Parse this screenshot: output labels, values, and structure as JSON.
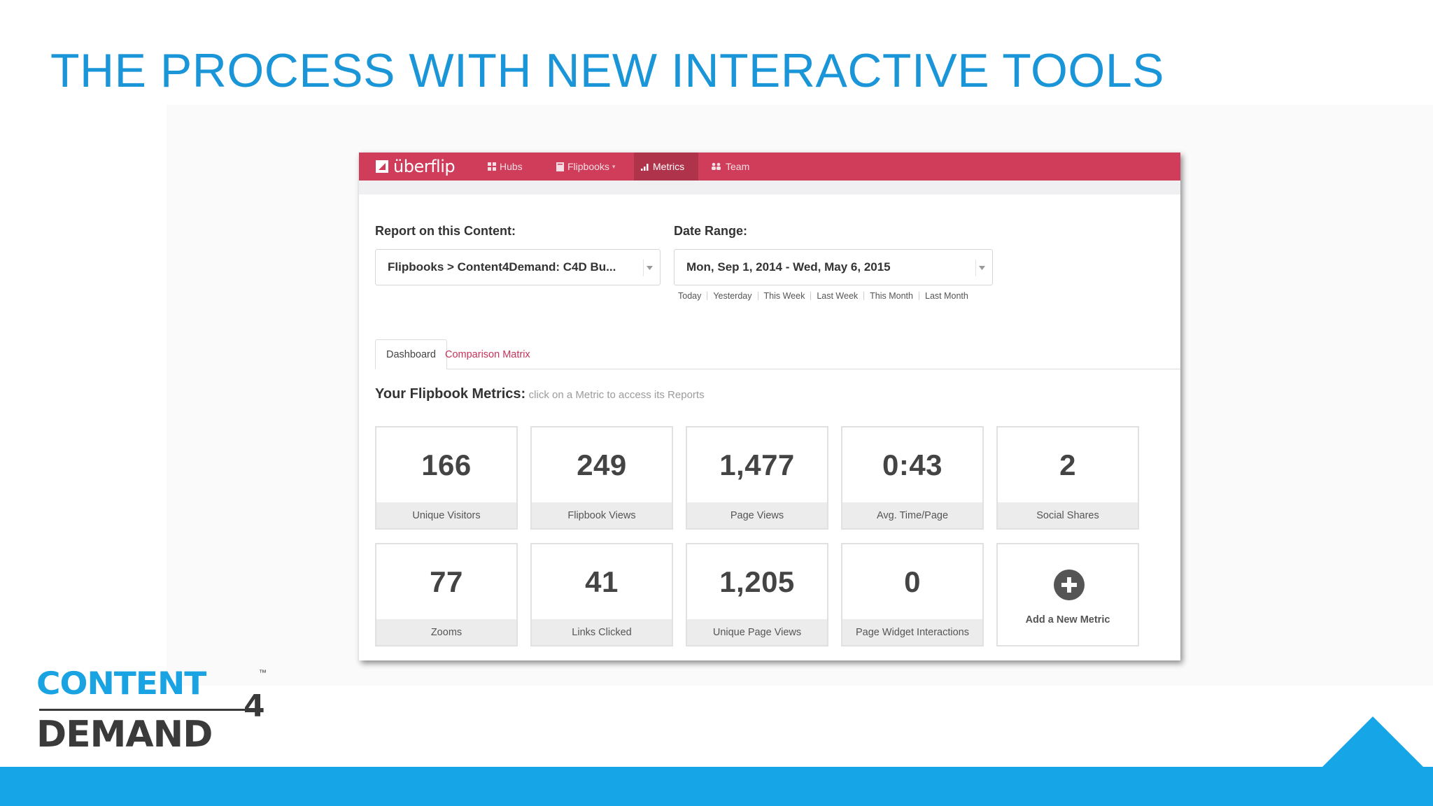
{
  "slide": {
    "title": "THE PROCESS WITH NEW INTERACTIVE TOOLS"
  },
  "app": {
    "logo_text": "überflip",
    "nav": [
      {
        "label": "Hubs",
        "icon": "grid-icon"
      },
      {
        "label": "Flipbooks",
        "icon": "book-icon"
      },
      {
        "label": "Metrics",
        "icon": "bar-chart-icon",
        "active": true
      },
      {
        "label": "Team",
        "icon": "people-icon"
      }
    ],
    "report": {
      "label": "Report on this Content:",
      "value": "Flipbooks > Content4Demand: C4D Bu..."
    },
    "date_range": {
      "label": "Date Range:",
      "value": "Mon, Sep 1, 2014 - Wed, May 6, 2015",
      "quick_links": [
        "Today",
        "Yesterday",
        "This Week",
        "Last Week",
        "This Month",
        "Last Month"
      ]
    },
    "tabs": [
      {
        "label": "Dashboard",
        "active": true
      },
      {
        "label": "Comparison Matrix",
        "active": false
      }
    ],
    "metrics_heading": "Your Flipbook Metrics:",
    "metrics_hint": "click on a Metric to access its Reports",
    "metrics": [
      {
        "value": "166",
        "label": "Unique Visitors"
      },
      {
        "value": "249",
        "label": "Flipbook Views"
      },
      {
        "value": "1,477",
        "label": "Page Views"
      },
      {
        "value": "0:43",
        "label": "Avg. Time/Page"
      },
      {
        "value": "2",
        "label": "Social Shares"
      },
      {
        "value": "77",
        "label": "Zooms"
      },
      {
        "value": "41",
        "label": "Links Clicked"
      },
      {
        "value": "1,205",
        "label": "Unique Page Views"
      },
      {
        "value": "0",
        "label": "Page Widget Interactions"
      }
    ],
    "add_metric_label": "Add a New Metric"
  },
  "brand": {
    "content": "CONTENT",
    "demand": "DEMAND",
    "four": "4",
    "tm": "™",
    "colors": {
      "accent": "#16a6e8",
      "title": "#1a96d8",
      "navbar": "#cf3d5a",
      "logo_dark": "#3a3a3a"
    }
  }
}
